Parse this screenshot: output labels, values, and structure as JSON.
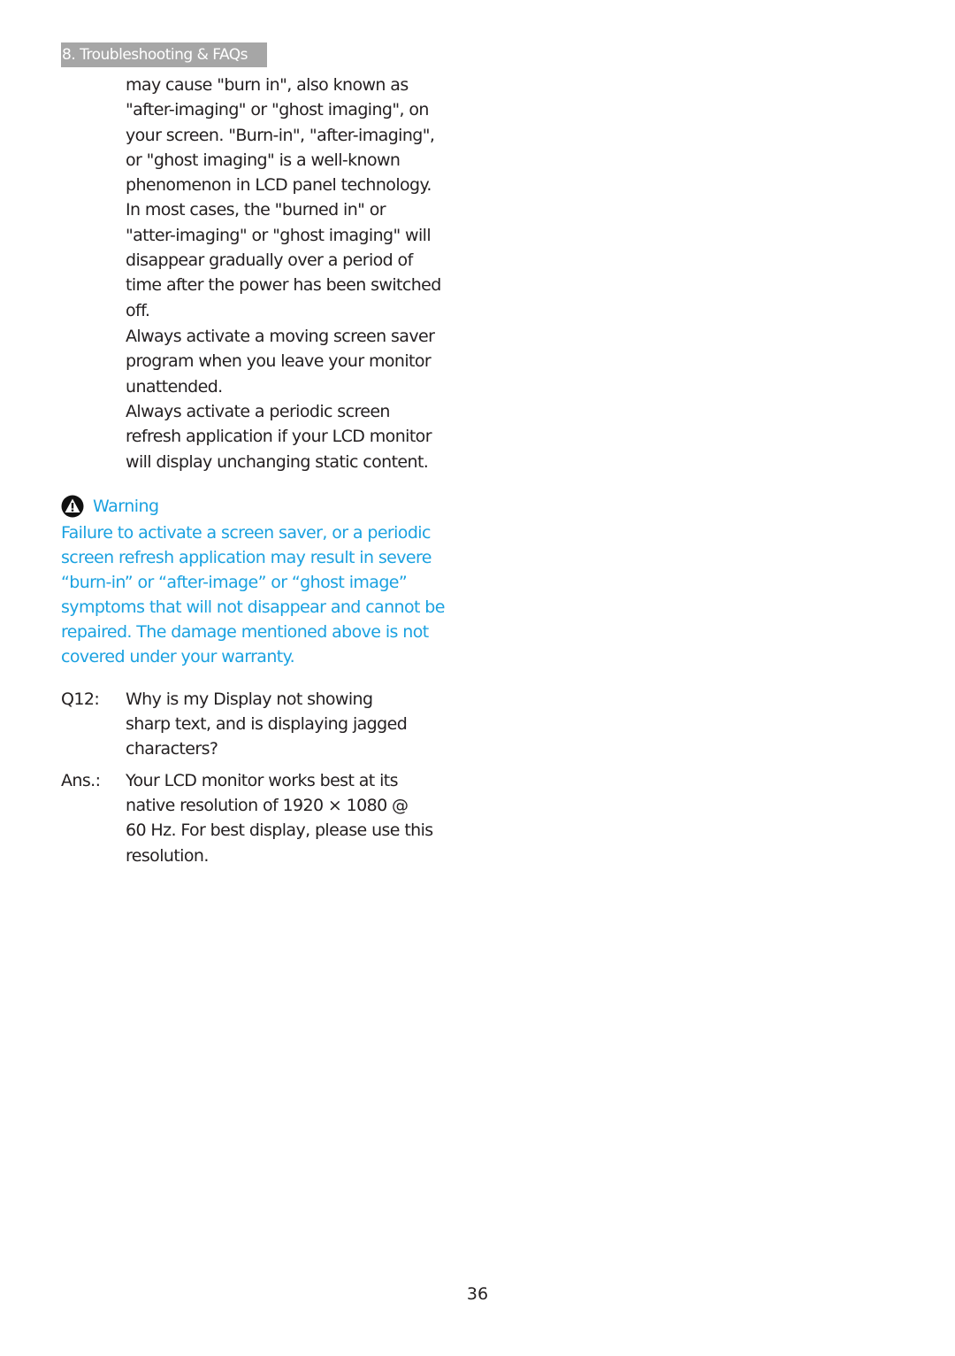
{
  "header": {
    "section_title": "8. Troubleshooting & FAQs"
  },
  "continued_paragraph": {
    "lines": [
      "may cause \"burn in\", also known as",
      "\"after-imaging\" or \"ghost imaging\", on",
      "your screen. \"Burn-in\", \"after-imaging\",",
      "or \"ghost imaging\" is a well-known",
      "phenomenon in LCD panel technology.",
      "In most cases, the \"burned in\" or",
      "\"atter-imaging\" or \"ghost imaging\" will",
      "disappear gradually over a period of",
      "time after the power has been switched",
      "off."
    ]
  },
  "screensaver_paragraph": {
    "lines": [
      "Always activate a moving screen saver",
      "program when you leave your monitor",
      "unattended."
    ]
  },
  "refresh_paragraph": {
    "lines": [
      "Always activate a periodic screen",
      "refresh application if your LCD monitor",
      "will display unchanging static content."
    ]
  },
  "warning": {
    "icon": "warning-triangle-icon",
    "title": "Warning",
    "color": "#1aa1e0",
    "lines": [
      "Failure to activate a screen saver, or a periodic",
      "screen refresh application may result in severe",
      "“burn-in” or “after-image” or “ghost image”",
      "symptoms that will not disappear and cannot be",
      "repaired. The damage mentioned above is not",
      "covered under your warranty."
    ]
  },
  "faq": {
    "question": {
      "label": "Q12:",
      "lines": [
        "Why is my Display not showing",
        "sharp text, and is displaying jagged",
        "characters?"
      ]
    },
    "answer": {
      "label": "Ans.:",
      "lines": [
        "Your LCD monitor works best at its",
        "native resolution of 1920 × 1080 @",
        "60 Hz. For best display, please use this",
        "resolution."
      ]
    }
  },
  "footer": {
    "page_number": "36"
  }
}
